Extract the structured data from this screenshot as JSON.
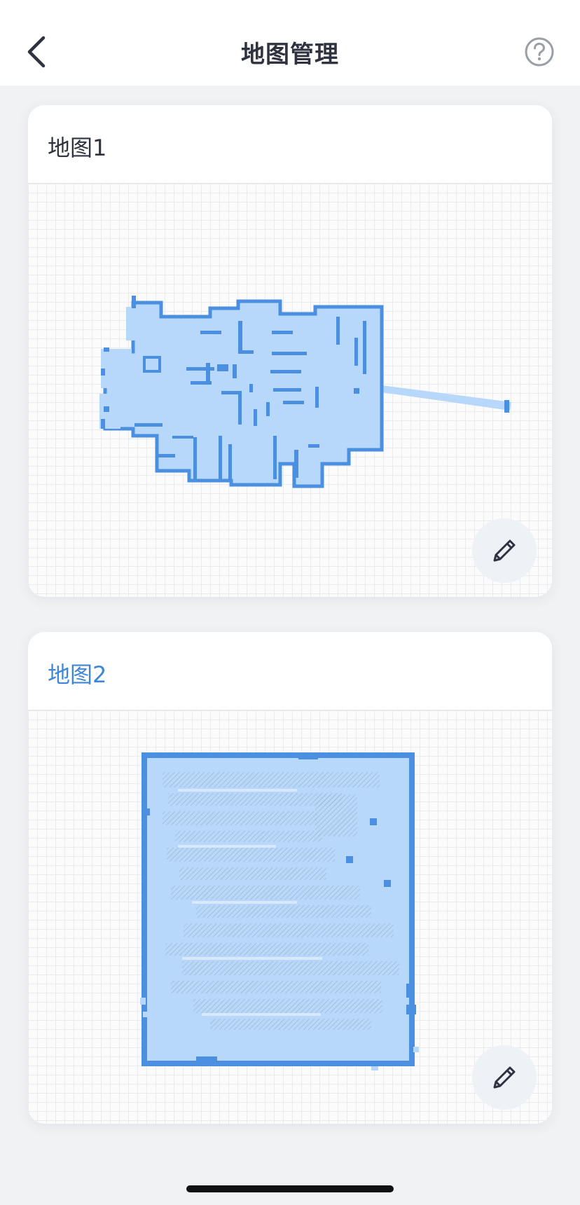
{
  "header": {
    "title": "地图管理",
    "back_icon": "chevron-left-icon",
    "help_icon": "question-circle-icon"
  },
  "maps": [
    {
      "title": "地图1",
      "selected": false,
      "edit_icon": "pencil-icon"
    },
    {
      "title": "地图2",
      "selected": true,
      "edit_icon": "pencil-icon"
    }
  ],
  "colors": {
    "accent": "#3e86d6",
    "map_wall": "#4a8fe0",
    "map_fill": "#b8d8fb",
    "map_trace": "#9eb3c9"
  }
}
